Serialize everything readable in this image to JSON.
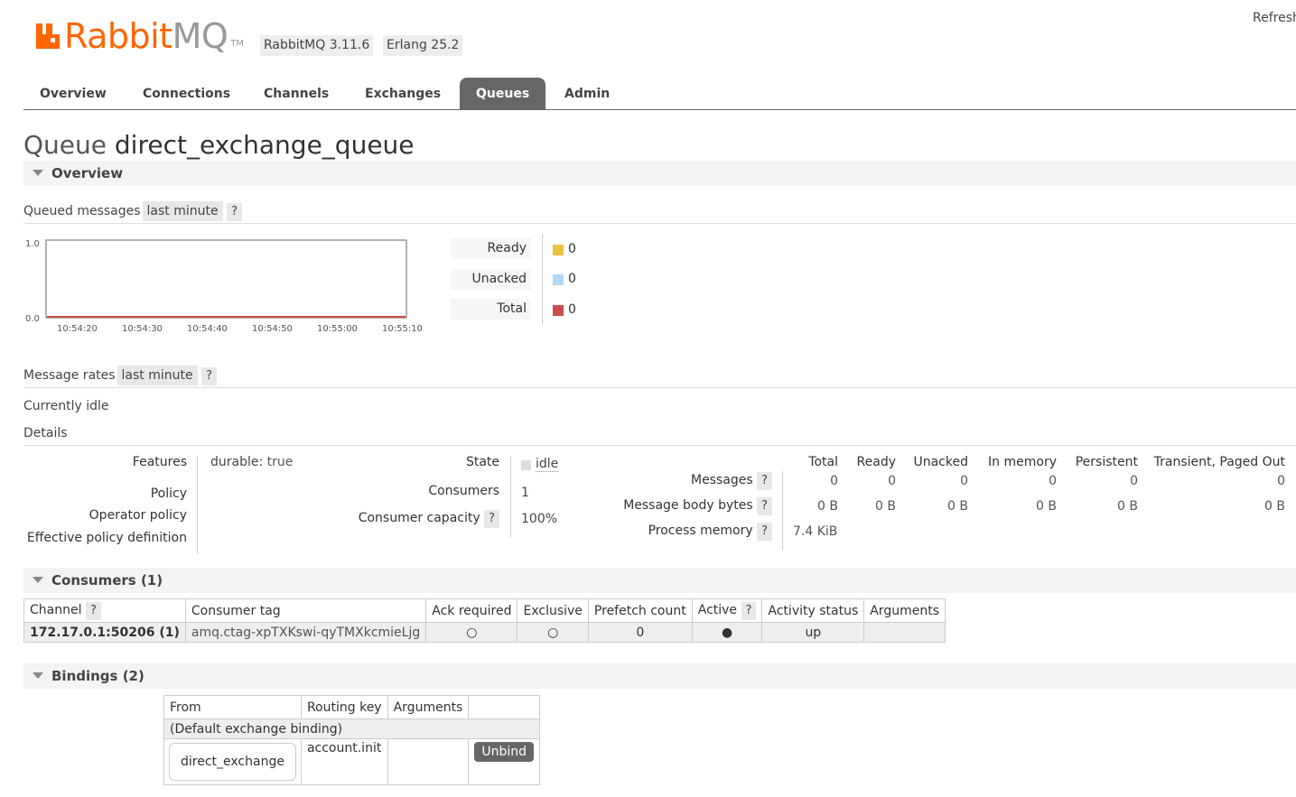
{
  "header": {
    "logo_brand": "Rabbit",
    "logo_suffix": "MQ",
    "logo_tm": "TM",
    "rabbitmq_version": "RabbitMQ 3.11.6",
    "erlang_version": "Erlang 25.2",
    "refresh_label": "Refresh"
  },
  "tabs": [
    {
      "label": "Overview",
      "active": false
    },
    {
      "label": "Connections",
      "active": false
    },
    {
      "label": "Channels",
      "active": false
    },
    {
      "label": "Exchanges",
      "active": false
    },
    {
      "label": "Queues",
      "active": true
    },
    {
      "label": "Admin",
      "active": false
    }
  ],
  "page": {
    "title_label": "Queue",
    "title_name": "direct_exchange_queue"
  },
  "overview": {
    "section_title": "Overview",
    "queued_messages_label": "Queued messages",
    "range_label": "last minute",
    "help": "?",
    "chart_data": {
      "type": "line",
      "title": "Queued messages",
      "x": [
        "10:54:20",
        "10:54:30",
        "10:54:40",
        "10:54:50",
        "10:55:00",
        "10:55:10"
      ],
      "ylim": [
        0.0,
        1.0
      ],
      "yticks": [
        "1.0",
        "0.0"
      ],
      "series": [
        {
          "name": "Ready",
          "color": "#edc240",
          "values": [
            0,
            0,
            0,
            0,
            0,
            0
          ]
        },
        {
          "name": "Unacked",
          "color": "#afd8f8",
          "values": [
            0,
            0,
            0,
            0,
            0,
            0
          ]
        },
        {
          "name": "Total",
          "color": "#cb4b4b",
          "values": [
            0,
            0,
            0,
            0,
            0,
            0
          ]
        }
      ]
    },
    "legend": [
      {
        "label": "Ready",
        "color": "#edc240",
        "value": "0"
      },
      {
        "label": "Unacked",
        "color": "#afd8f8",
        "value": "0"
      },
      {
        "label": "Total",
        "color": "#cb4b4b",
        "value": "0"
      }
    ],
    "message_rates_label": "Message rates",
    "rates_range_label": "last minute",
    "idle_text": "Currently idle",
    "details_label": "Details",
    "features_label": "Features",
    "durable_key": "durable:",
    "durable_value": "true",
    "policy_label": "Policy",
    "operator_policy_label": "Operator policy",
    "effective_policy_label": "Effective policy definition",
    "state_label": "State",
    "state_value": "idle",
    "consumers_label": "Consumers",
    "consumers_value": "1",
    "consumer_capacity_label": "Consumer capacity",
    "consumer_capacity_value": "100%",
    "stats_columns": [
      "Total",
      "Ready",
      "Unacked",
      "In memory",
      "Persistent",
      "Transient, Paged Out"
    ],
    "messages_label": "Messages",
    "messages_values": [
      "0",
      "0",
      "0",
      "0",
      "0",
      "0"
    ],
    "body_bytes_label": "Message body bytes",
    "body_bytes_values": [
      "0 B",
      "0 B",
      "0 B",
      "0 B",
      "0 B",
      "0 B"
    ],
    "process_memory_label": "Process memory",
    "process_memory_value": "7.4 KiB"
  },
  "consumers": {
    "section_title": "Consumers (1)",
    "columns": [
      "Channel",
      "Consumer tag",
      "Ack required",
      "Exclusive",
      "Prefetch count",
      "Active",
      "Activity status",
      "Arguments"
    ],
    "rows": [
      {
        "channel": "172.17.0.1:50206 (1)",
        "consumer_tag": "amq.ctag-xpTXKswi-qyTMXkcmieLjg",
        "ack_required": "○",
        "exclusive": "○",
        "prefetch_count": "0",
        "active": "●",
        "activity_status": "up",
        "arguments": ""
      }
    ]
  },
  "bindings": {
    "section_title": "Bindings (2)",
    "columns": [
      "From",
      "Routing key",
      "Arguments",
      ""
    ],
    "default_binding": "(Default exchange binding)",
    "rows": [
      {
        "from": "direct_exchange",
        "routing_key": "account.init",
        "arguments": "",
        "action": "Unbind"
      }
    ]
  }
}
